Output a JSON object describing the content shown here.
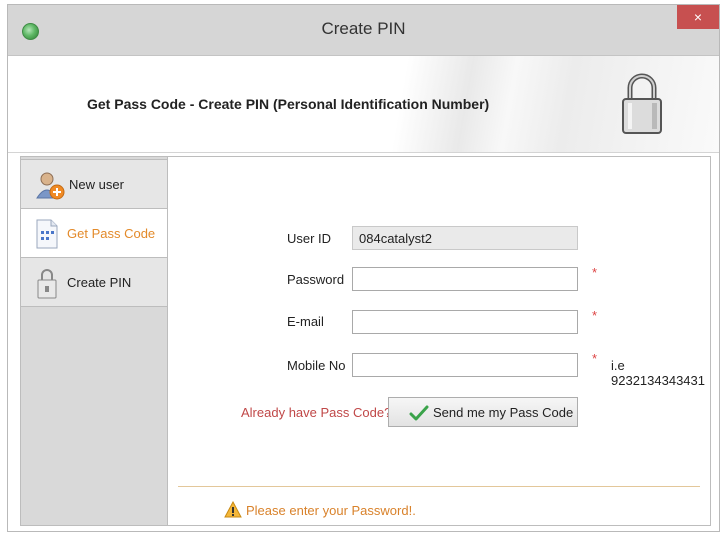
{
  "window": {
    "title": "Create PIN",
    "close_glyph": "×"
  },
  "header": {
    "title": "Get Pass Code - Create PIN (Personal Identification Number)"
  },
  "sidebar": {
    "items": [
      {
        "label": "New user",
        "icon": "user-add-icon"
      },
      {
        "label": "Get Pass Code",
        "icon": "document-icon",
        "active": true
      },
      {
        "label": "Create PIN",
        "icon": "lock-document-icon"
      }
    ]
  },
  "form": {
    "user_id": {
      "label": "User ID",
      "value": "084catalyst2"
    },
    "password": {
      "label": "Password",
      "value": "",
      "required_mark": "*"
    },
    "email": {
      "label": "E-mail",
      "value": "",
      "required_mark": "*"
    },
    "mobile": {
      "label": "Mobile No",
      "value": "",
      "required_mark": "*",
      "hint": "i.e 9232134343431"
    },
    "pass_code_link": "Already have Pass Code?",
    "send_button": "Send me my Pass Code"
  },
  "status": {
    "message": "Please enter your Password!.",
    "icon": "warning-icon"
  },
  "colors": {
    "accent_orange": "#e38a2a",
    "link_red": "#c04848",
    "close_red": "#c75050"
  }
}
